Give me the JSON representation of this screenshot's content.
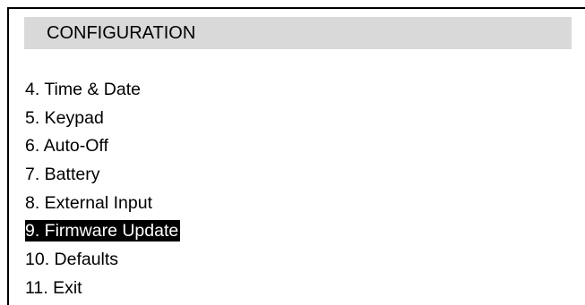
{
  "menu": {
    "title": "CONFIGURATION",
    "selected_index": 5,
    "items": [
      {
        "label": "4. Time & Date"
      },
      {
        "label": "5. Keypad"
      },
      {
        "label": "6. Auto-Off"
      },
      {
        "label": "7. Battery"
      },
      {
        "label": "8. External Input"
      },
      {
        "label": "9. Firmware Update"
      },
      {
        "label": "10. Defaults"
      },
      {
        "label": "11. Exit"
      }
    ]
  },
  "colors": {
    "header_background": "#d9d9d9",
    "selection_background": "#000000",
    "selection_text": "#ffffff",
    "text": "#000000",
    "border": "#000000"
  }
}
